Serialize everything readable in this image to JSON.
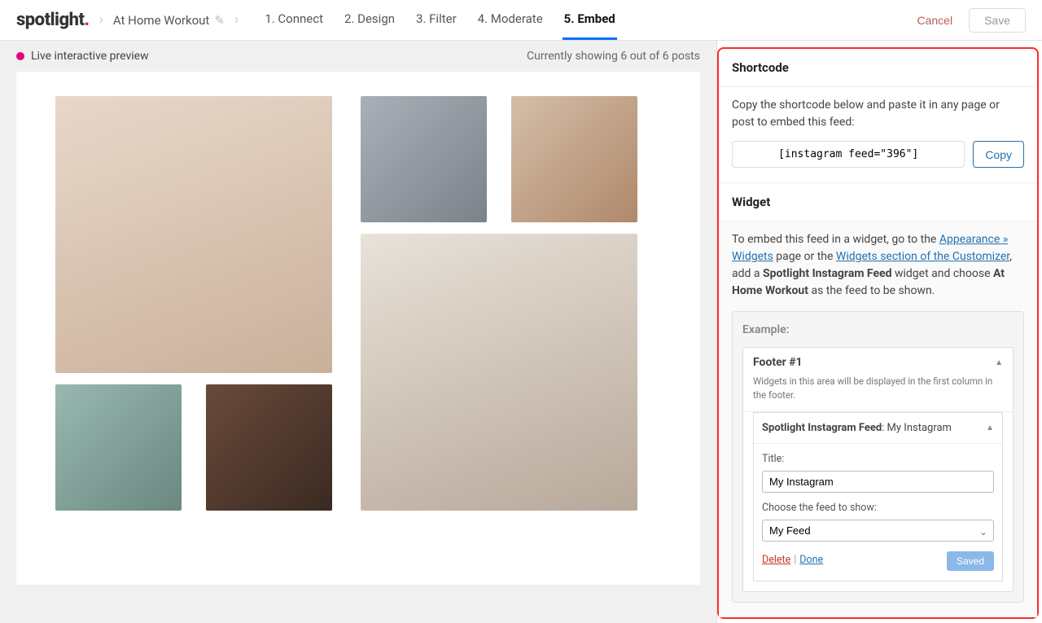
{
  "logo": {
    "text": "spotlight",
    "dot": "."
  },
  "feed_name": "At Home Workout",
  "tabs": [
    {
      "label": "1. Connect"
    },
    {
      "label": "2. Design"
    },
    {
      "label": "3. Filter"
    },
    {
      "label": "4. Moderate"
    },
    {
      "label": "5. Embed"
    }
  ],
  "buttons": {
    "cancel": "Cancel",
    "save": "Save",
    "copy": "Copy"
  },
  "preview": {
    "live_label": "Live interactive preview",
    "showing": "Currently showing 6 out of 6 posts"
  },
  "shortcode": {
    "title": "Shortcode",
    "desc": "Copy the shortcode below and paste it in any page or post to embed this feed:",
    "code": "[instagram feed=\"396\"]"
  },
  "widget": {
    "title": "Widget",
    "desc_pre": "To embed this feed in a widget, go to the ",
    "link1": "Appearance » Widgets",
    "desc_mid": " page or the ",
    "link2": "Widgets section of the Customizer",
    "desc_post1": ", add a ",
    "bold1": "Spotlight Instagram Feed",
    "desc_post2": " widget and choose ",
    "bold2": "At Home Workout",
    "desc_post3": " as the feed to be shown.",
    "example_label": "Example:",
    "area_title": "Footer #1",
    "area_sub": "Widgets in this area will be displayed in the first column in the footer.",
    "item_name": "Spotlight Instagram Feed",
    "item_suffix": ": My Instagram",
    "title_label": "Title:",
    "title_value": "My Instagram",
    "choose_label": "Choose the feed to show:",
    "choose_value": "My Feed",
    "delete": "Delete",
    "done": "Done",
    "saved": "Saved"
  }
}
